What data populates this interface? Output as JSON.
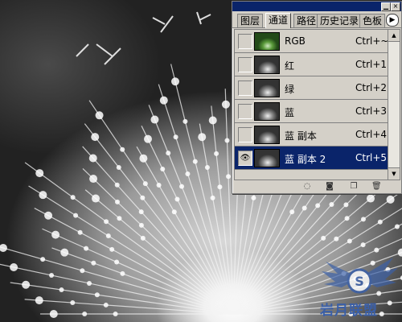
{
  "palette": {
    "tabs": [
      "图层",
      "通道",
      "路径",
      "历史记录",
      "色板"
    ],
    "active_tab": "通道",
    "menu_icon": "palette-menu-arrow-icon",
    "titlebar_buttons": [
      "minimize-icon",
      "close-icon"
    ]
  },
  "channels": [
    {
      "name": "RGB",
      "shortcut": "Ctrl+~",
      "visible": false,
      "selected": false
    },
    {
      "name": "红",
      "shortcut": "Ctrl+1",
      "visible": false,
      "selected": false
    },
    {
      "name": "绿",
      "shortcut": "Ctrl+2",
      "visible": false,
      "selected": false
    },
    {
      "name": "蓝",
      "shortcut": "Ctrl+3",
      "visible": false,
      "selected": false
    },
    {
      "name": "蓝 副本",
      "shortcut": "Ctrl+4",
      "visible": false,
      "selected": false
    },
    {
      "name": "蓝 副本 2",
      "shortcut": "Ctrl+5",
      "visible": true,
      "selected": true
    }
  ],
  "bottom_icons": [
    "load-selection-icon",
    "save-selection-icon",
    "new-channel-icon",
    "trash-icon"
  ],
  "watermark": {
    "text": "岩月联盟",
    "badge": "S"
  },
  "colors": {
    "selected_row": "#0a246a",
    "panel": "#d4d0c8",
    "logo": "#3a5fa8"
  }
}
